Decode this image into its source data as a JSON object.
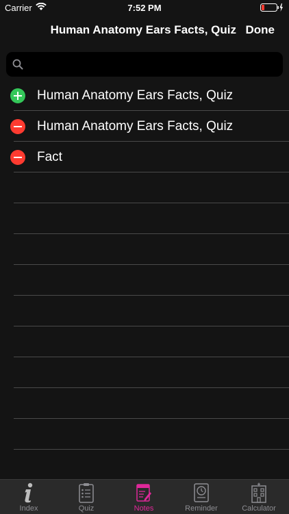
{
  "status": {
    "carrier": "Carrier",
    "time": "7:52 PM"
  },
  "nav": {
    "title": "Human Anatomy Ears Facts, Quiz",
    "done_label": "Done"
  },
  "search": {
    "placeholder": "",
    "value": ""
  },
  "rows": [
    {
      "label": "Human Anatomy Ears Facts, Quiz",
      "action": "add"
    },
    {
      "label": "Human Anatomy Ears Facts, Quiz",
      "action": "delete"
    },
    {
      "label": "Fact",
      "action": "delete"
    }
  ],
  "empty_rows": 10,
  "tabs": [
    {
      "label": "Index",
      "icon": "info-icon",
      "active": false
    },
    {
      "label": "Quiz",
      "icon": "quiz-clipboard-icon",
      "active": false
    },
    {
      "label": "Notes",
      "icon": "notes-icon",
      "active": true
    },
    {
      "label": "Reminder",
      "icon": "reminder-clock-icon",
      "active": false
    },
    {
      "label": "Calculator",
      "icon": "calculator-building-icon",
      "active": false
    }
  ],
  "colors": {
    "add": "#34c759",
    "delete": "#ff3b30",
    "active_tab": "#e0289a",
    "battery_low": "#ff3b30"
  }
}
